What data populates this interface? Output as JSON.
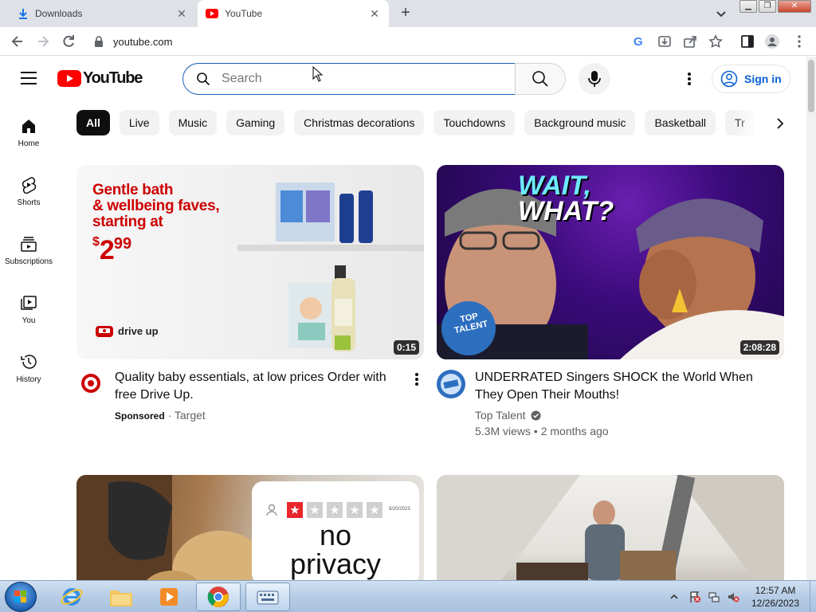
{
  "browser": {
    "tabs": [
      {
        "title": "Downloads",
        "icon": "download-icon"
      },
      {
        "title": "YouTube",
        "icon": "youtube-favicon"
      }
    ],
    "address": "youtube.com"
  },
  "masthead": {
    "logo_text": "YouTube",
    "search_placeholder": "Search",
    "signin_label": "Sign in"
  },
  "guide": {
    "items": [
      {
        "label": "Home",
        "icon": "home-icon"
      },
      {
        "label": "Shorts",
        "icon": "shorts-icon"
      },
      {
        "label": "Subscriptions",
        "icon": "subscriptions-icon"
      },
      {
        "label": "You",
        "icon": "you-icon"
      },
      {
        "label": "History",
        "icon": "history-icon"
      }
    ]
  },
  "chips": [
    "All",
    "Live",
    "Music",
    "Gaming",
    "Christmas decorations",
    "Touchdowns",
    "Background music",
    "Basketball",
    "Tr"
  ],
  "videos": [
    {
      "title": "Quality baby essentials, at low prices Order with free Drive Up.",
      "sponsored_label": "Sponsored",
      "channel": "Target",
      "duration": "0:15",
      "thumb": {
        "headline_1": "Gentle bath",
        "headline_2": "& wellbeing faves,",
        "headline_3": "starting at",
        "price_currency": "$",
        "price_dollars": "2",
        "price_cents": "99",
        "drive_up": "drive up"
      }
    },
    {
      "title": "UNDERRATED Singers SHOCK the World When They Open Their Mouths!",
      "channel": "Top Talent",
      "views": "5.3M views",
      "age": "2 months ago",
      "duration": "2:08:28",
      "thumb": {
        "wait": "WAIT,",
        "what": "WHAT?",
        "badge_top": "TOP",
        "badge_talent": "TALENT"
      }
    },
    {
      "thumb": {
        "line1": "no",
        "line2": "privacy",
        "review_date": "8/20/2023",
        "rating": 1,
        "max_rating": 5
      }
    },
    {
      "thumb": {}
    }
  ],
  "taskbar": {
    "time": "12:57 AM",
    "date": "12/26/2023"
  },
  "colors": {
    "youtube_red": "#ff0000",
    "link_blue": "#065fd4",
    "target_red": "#cc0000",
    "star_red": "#e8262b"
  }
}
